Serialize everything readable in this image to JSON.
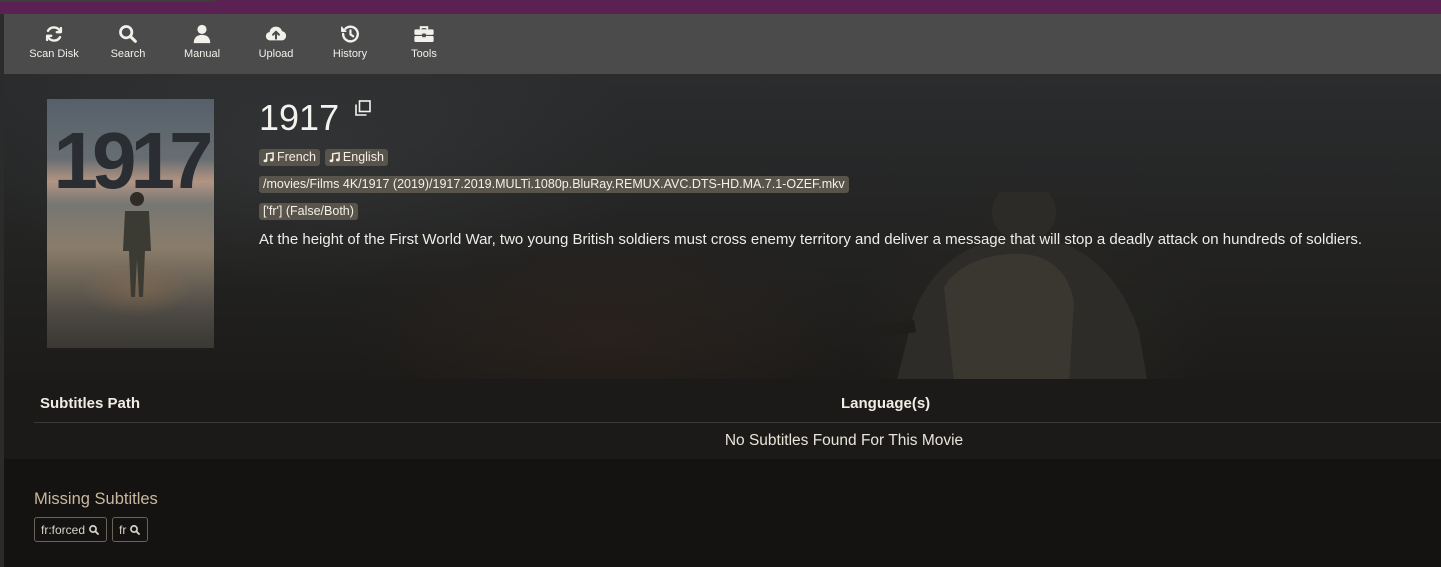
{
  "toolbar": {
    "items": [
      {
        "label": "Scan Disk",
        "icon": "sync-icon"
      },
      {
        "label": "Search",
        "icon": "search-icon"
      },
      {
        "label": "Manual",
        "icon": "user-icon"
      },
      {
        "label": "Upload",
        "icon": "cloud-upload-icon"
      },
      {
        "label": "History",
        "icon": "history-icon"
      },
      {
        "label": "Tools",
        "icon": "toolbox-icon"
      }
    ]
  },
  "movie": {
    "poster_text": "1917",
    "title": "1917",
    "audio_languages": [
      "French",
      "English"
    ],
    "path": "/movies/Films 4K/1917 (2019)/1917.2019.MULTi.1080p.BluRay.REMUX.AVC.DTS-HD.MA.7.1-OZEF.mkv",
    "profile": "['fr'] (False/Both)",
    "overview": "At the height of the First World War, two young British soldiers must cross enemy territory and deliver a message that will stop a deadly attack on hundreds of soldiers."
  },
  "subtitles_table": {
    "col_path": "Subtitles Path",
    "col_language": "Language(s)",
    "empty_message": "No Subtitles Found For This Movie"
  },
  "missing": {
    "title": "Missing Subtitles",
    "items": [
      "fr:forced",
      "fr"
    ]
  },
  "colors": {
    "top_accent": "#5a2152",
    "toolbar_bg": "#4b4b4b",
    "badge_bg": "#59544b",
    "page_bg": "#141312"
  }
}
